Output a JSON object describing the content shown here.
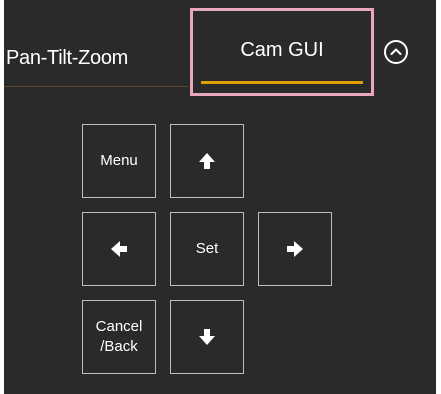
{
  "tabs": {
    "ptz_label": "Pan-Tilt-Zoom",
    "cam_gui_label": "Cam GUI"
  },
  "collapse_icon": "chevron-up-circle-icon",
  "keypad": {
    "menu_label": "Menu",
    "set_label": "Set",
    "cancel_label_line1": "Cancel",
    "cancel_label_line2": "/Back",
    "up_icon": "arrow-up-icon",
    "down_icon": "arrow-down-icon",
    "left_icon": "arrow-left-icon",
    "right_icon": "arrow-right-icon"
  },
  "colors": {
    "panel_bg": "#2a2a2a",
    "active_tab_underline": "#e0a000",
    "highlight_outline": "#e8a6c0",
    "key_border": "#bdbdbd"
  }
}
